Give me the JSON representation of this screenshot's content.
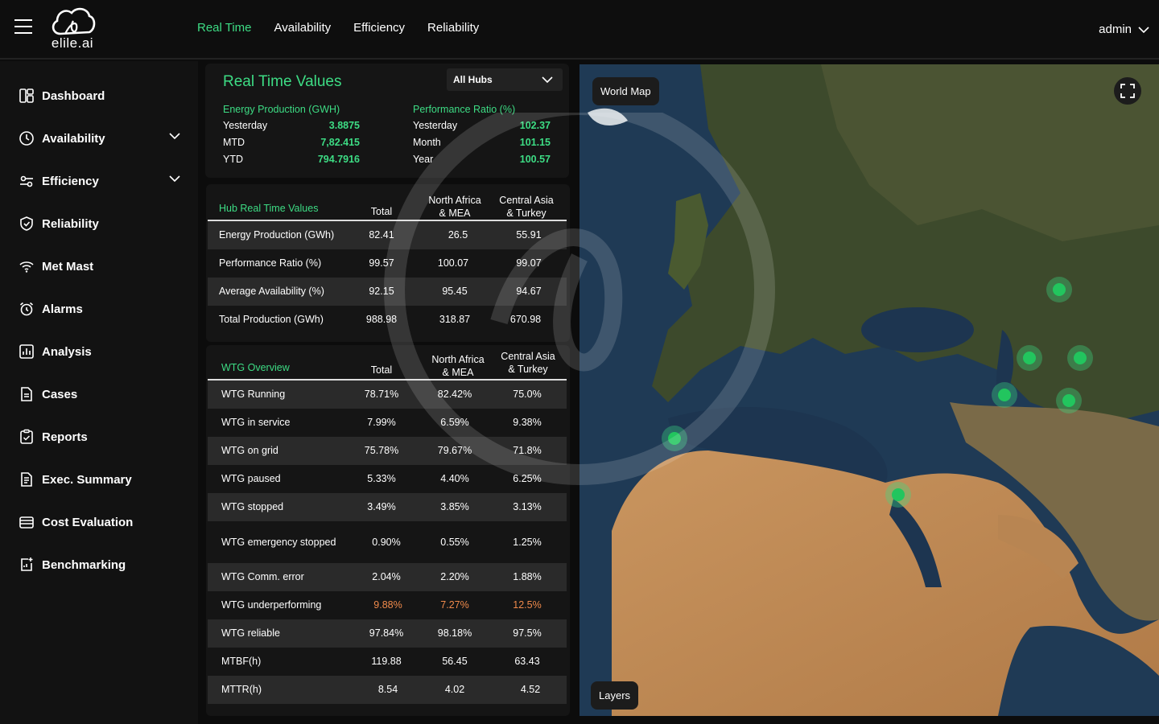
{
  "brand": {
    "name": "elile.ai"
  },
  "topnav": {
    "items": [
      {
        "label": "Real Time",
        "active": true
      },
      {
        "label": "Availability",
        "active": false
      },
      {
        "label": "Efficiency",
        "active": false
      },
      {
        "label": "Reliability",
        "active": false
      }
    ],
    "user": "admin"
  },
  "sidebar": {
    "items": [
      {
        "label": "Dashboard",
        "icon": "dashboard-icon"
      },
      {
        "label": "Availability",
        "icon": "clock-icon",
        "expandable": true
      },
      {
        "label": "Efficiency",
        "icon": "toggles-icon",
        "expandable": true
      },
      {
        "label": "Reliability",
        "icon": "shield-icon"
      },
      {
        "label": "Met Mast",
        "icon": "wifi-icon"
      },
      {
        "label": "Alarms",
        "icon": "alarm-clock-icon"
      },
      {
        "label": "Analysis",
        "icon": "bar-chart-icon"
      },
      {
        "label": "Cases",
        "icon": "document-icon"
      },
      {
        "label": "Reports",
        "icon": "clipboard-icon"
      },
      {
        "label": "Exec. Summary",
        "icon": "summary-icon"
      },
      {
        "label": "Cost Evaluation",
        "icon": "cost-icon"
      },
      {
        "label": "Benchmarking",
        "icon": "benchmark-icon"
      }
    ]
  },
  "realtime": {
    "title": "Real Time Values",
    "hub_select": "All Hubs",
    "energy": {
      "header": "Energy Production (GWH)",
      "rows": [
        {
          "label": "Yesterday",
          "value": "3.8875"
        },
        {
          "label": "MTD",
          "value": "7,82.415"
        },
        {
          "label": "YTD",
          "value": "794.7916"
        }
      ]
    },
    "performance": {
      "header": "Performance Ratio (%)",
      "rows": [
        {
          "label": "Yesterday",
          "value": "102.37"
        },
        {
          "label": "Month",
          "value": "101.15"
        },
        {
          "label": "Year",
          "value": "100.57"
        }
      ]
    }
  },
  "hub_table": {
    "headers": [
      "Hub Real Time Values",
      "Total",
      "North Africa\n& MEA",
      "Central Asia\n& Turkey"
    ],
    "rows": [
      [
        "Energy Production (GWh)",
        "82.41",
        "26.5",
        "55.91"
      ],
      [
        "Performance Ratio (%)",
        "99.57",
        "100.07",
        "99.07"
      ],
      [
        "Average Availability (%)",
        "92.15",
        "95.45",
        "94.67"
      ],
      [
        "Total Production (GWh)",
        "988.98",
        "318.87",
        "670.98"
      ]
    ]
  },
  "wtg_table": {
    "headers": [
      "WTG Overview",
      "Total",
      "North Africa\n& MEA",
      "Central Asia\n& Turkey"
    ],
    "rows": [
      [
        "WTG Running",
        "78.71%",
        "82.42%",
        "75.0%"
      ],
      [
        "WTG in service",
        "7.99%",
        "6.59%",
        "9.38%"
      ],
      [
        "WTG on grid",
        "75.78%",
        "79.67%",
        "71.8%"
      ],
      [
        "WTG paused",
        "5.33%",
        "4.40%",
        "6.25%"
      ],
      [
        "WTG stopped",
        "3.49%",
        "3.85%",
        "3.13%"
      ],
      [
        "WTG emergency stopped",
        "0.90%",
        "0.55%",
        "1.25%"
      ],
      [
        "WTG Comm. error",
        "2.04%",
        "2.20%",
        "1.88%"
      ],
      [
        "WTG underperforming",
        "9.88%",
        "7.27%",
        "12.5%"
      ],
      [
        "WTG reliable",
        "97.84%",
        "98.18%",
        "97.5%"
      ],
      [
        "MTBF(h)",
        "119.88",
        "56.45",
        "63.43"
      ],
      [
        "MTTR(h)",
        "8.54",
        "4.02",
        "4.52"
      ]
    ]
  },
  "map": {
    "title_chip": "World Map",
    "layers_chip": "Layers"
  },
  "colors": {
    "accent": "#3ddc84",
    "warning": "#f08a4b",
    "background": "#0c0c0c"
  }
}
